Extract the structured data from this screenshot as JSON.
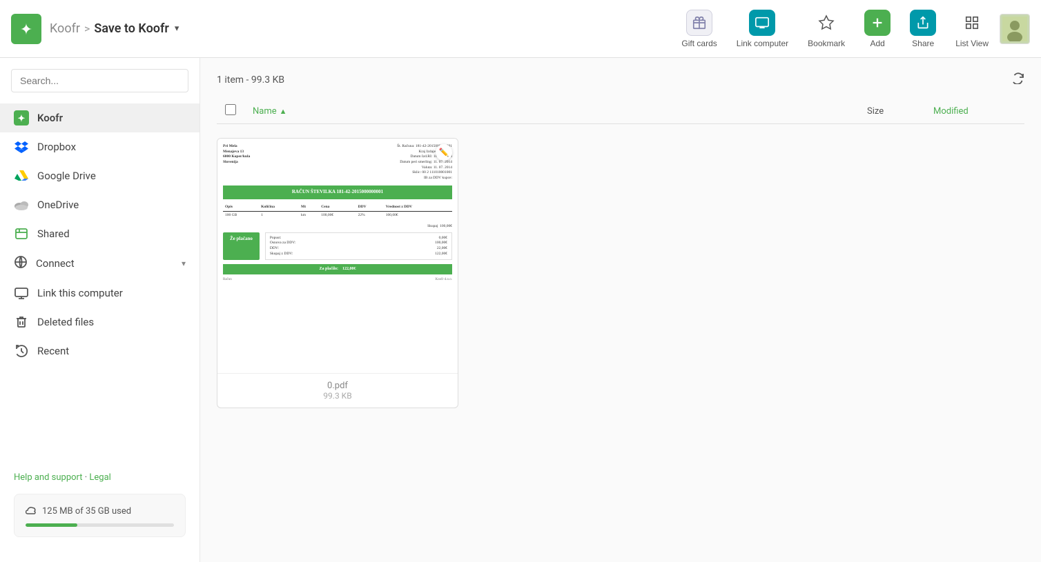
{
  "header": {
    "logo_alt": "Koofr logo",
    "breadcrumb": {
      "root": "Koofr",
      "separator": ">",
      "current": "Save to Koofr",
      "arrow": "▾"
    },
    "actions": [
      {
        "id": "gift-cards",
        "label": "Gift cards",
        "icon": "gift-icon",
        "icon_type": "gift"
      },
      {
        "id": "link-computer",
        "label": "Link computer",
        "icon": "link-icon",
        "icon_type": "link"
      },
      {
        "id": "bookmark",
        "label": "Bookmark",
        "icon": "bookmark-icon",
        "icon_type": "bookmark"
      },
      {
        "id": "add",
        "label": "Add",
        "icon": "add-icon",
        "icon_type": "add"
      },
      {
        "id": "share",
        "label": "Share",
        "icon": "share-icon",
        "icon_type": "share"
      },
      {
        "id": "list-view",
        "label": "List View",
        "icon": "list-view-icon",
        "icon_type": "listview"
      }
    ],
    "avatar_alt": "User avatar"
  },
  "sidebar": {
    "search_placeholder": "Search...",
    "nav_items": [
      {
        "id": "koofr",
        "label": "Koofr",
        "icon": "koofr-nav-icon",
        "active": true
      },
      {
        "id": "dropbox",
        "label": "Dropbox",
        "icon": "dropbox-icon"
      },
      {
        "id": "google-drive",
        "label": "Google Drive",
        "icon": "google-drive-icon"
      },
      {
        "id": "onedrive",
        "label": "OneDrive",
        "icon": "onedrive-icon"
      },
      {
        "id": "shared",
        "label": "Shared",
        "icon": "shared-icon"
      },
      {
        "id": "link-computer",
        "label": "Link this computer",
        "icon": "link-computer-icon"
      },
      {
        "id": "deleted",
        "label": "Deleted files",
        "icon": "deleted-icon"
      },
      {
        "id": "recent",
        "label": "Recent",
        "icon": "recent-icon"
      }
    ],
    "connect_label": "Connect",
    "footer": {
      "help_text": "Help and support",
      "separator": "·",
      "legal_text": "Legal"
    },
    "storage": {
      "label": "125 MB of 35 GB used",
      "used_percent": 0.35,
      "icon": "cloud-icon"
    }
  },
  "content": {
    "item_count": "1 item - 99.3 KB",
    "columns": {
      "name": "Name",
      "name_sort": "▲",
      "size": "Size",
      "modified": "Modified"
    },
    "files": [
      {
        "id": "file-1",
        "name": "0.pdf",
        "size": "99.3 KB",
        "invoice_title": "RAČUN ŠTEVILKA 181-42-2015000000001",
        "paid_label": "Že plačano",
        "total_label": "Za plačilo:",
        "total_amount": "122,00€",
        "subtotal_label": "Skupaj",
        "subtotal_amount": "100,00€",
        "table_headers": [
          "Opis",
          "Količina",
          "Mt",
          "Cena",
          "DDV",
          "Vrednast z DDV"
        ],
        "table_rows": [
          [
            "100 GB",
            "1",
            "km",
            "100,00€",
            "22%",
            "100,00€"
          ]
        ],
        "summary_rows": [
          [
            "Popust:",
            "0,00€"
          ],
          [
            "Osnova za DDV:",
            "100,00€"
          ],
          [
            "DDV:",
            "22,00€"
          ],
          [
            "Skupaj z DDV:",
            "122,00€"
          ]
        ]
      }
    ],
    "refresh_icon": "refresh-icon"
  }
}
